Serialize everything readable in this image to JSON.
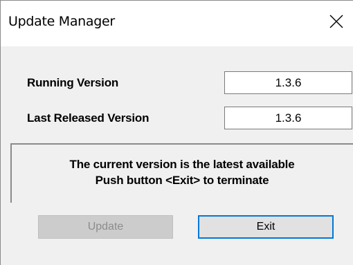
{
  "window": {
    "title": "Update Manager",
    "close_icon": "close-icon"
  },
  "versions": {
    "running_label": "Running Version",
    "running_value": "1.3.6",
    "released_label": "Last Released Version",
    "released_value": "1.3.6"
  },
  "message": {
    "line1": "The current version is the latest available",
    "line2": "Push button <Exit> to terminate"
  },
  "buttons": {
    "update_label": "Update",
    "update_enabled": false,
    "exit_label": "Exit"
  },
  "colors": {
    "focus_accent": "#0078d7",
    "dialog_background": "#f0f0f0"
  }
}
